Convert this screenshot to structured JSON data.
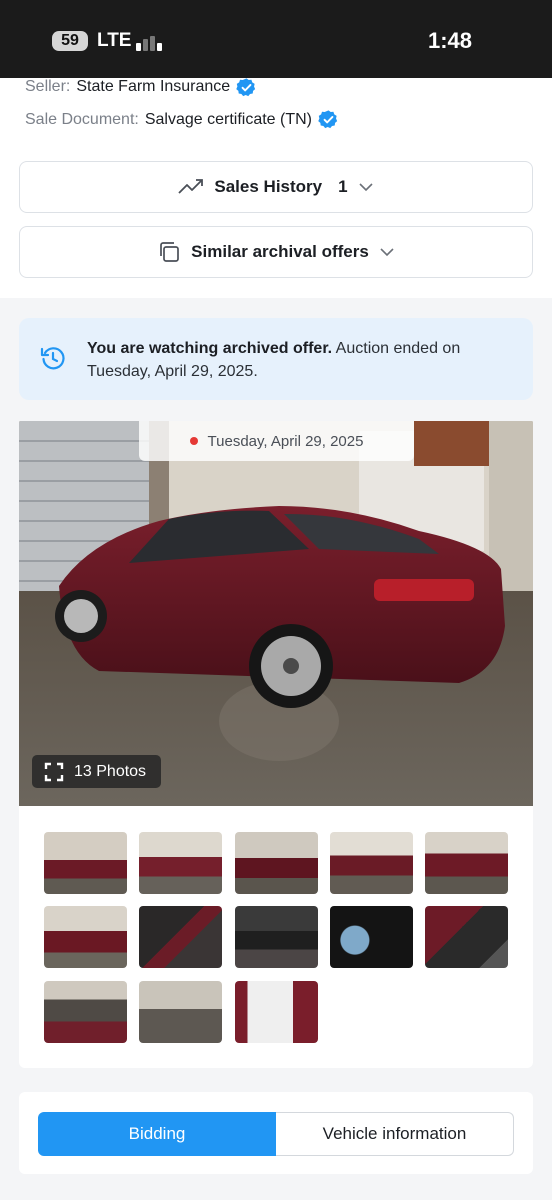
{
  "status_bar": {
    "battery": "59",
    "network": "LTE",
    "time": "1:48"
  },
  "seller": {
    "label": "Seller:",
    "value": "State Farm Insurance"
  },
  "sale_document": {
    "label": "Sale Document:",
    "value": "Salvage certificate (TN)"
  },
  "sales_history": {
    "label": "Sales History",
    "count": "1"
  },
  "similar_offers": {
    "label": "Similar archival offers"
  },
  "archive_banner": {
    "bold": "You are watching archived offer.",
    "text": " Auction ended on Tuesday, April 29, 2025."
  },
  "main_photo": {
    "date": "Tuesday, April 29, 2025",
    "photos_label": "13 Photos"
  },
  "thumbnails": [
    {
      "name": "thumb-front-left"
    },
    {
      "name": "thumb-side-left"
    },
    {
      "name": "thumb-rear-left"
    },
    {
      "name": "thumb-front-damaged"
    },
    {
      "name": "thumb-front"
    },
    {
      "name": "thumb-rear"
    },
    {
      "name": "thumb-interior-front"
    },
    {
      "name": "thumb-dashboard"
    },
    {
      "name": "thumb-gauges"
    },
    {
      "name": "thumb-interior-rear"
    },
    {
      "name": "thumb-engine"
    },
    {
      "name": "thumb-parts"
    },
    {
      "name": "thumb-label"
    }
  ],
  "tabs": {
    "bidding": "Bidding",
    "vehicle_info": "Vehicle information"
  },
  "colors": {
    "accent": "#2196f3",
    "verified": "#2196f3",
    "banner_bg": "#e6f1fc"
  }
}
